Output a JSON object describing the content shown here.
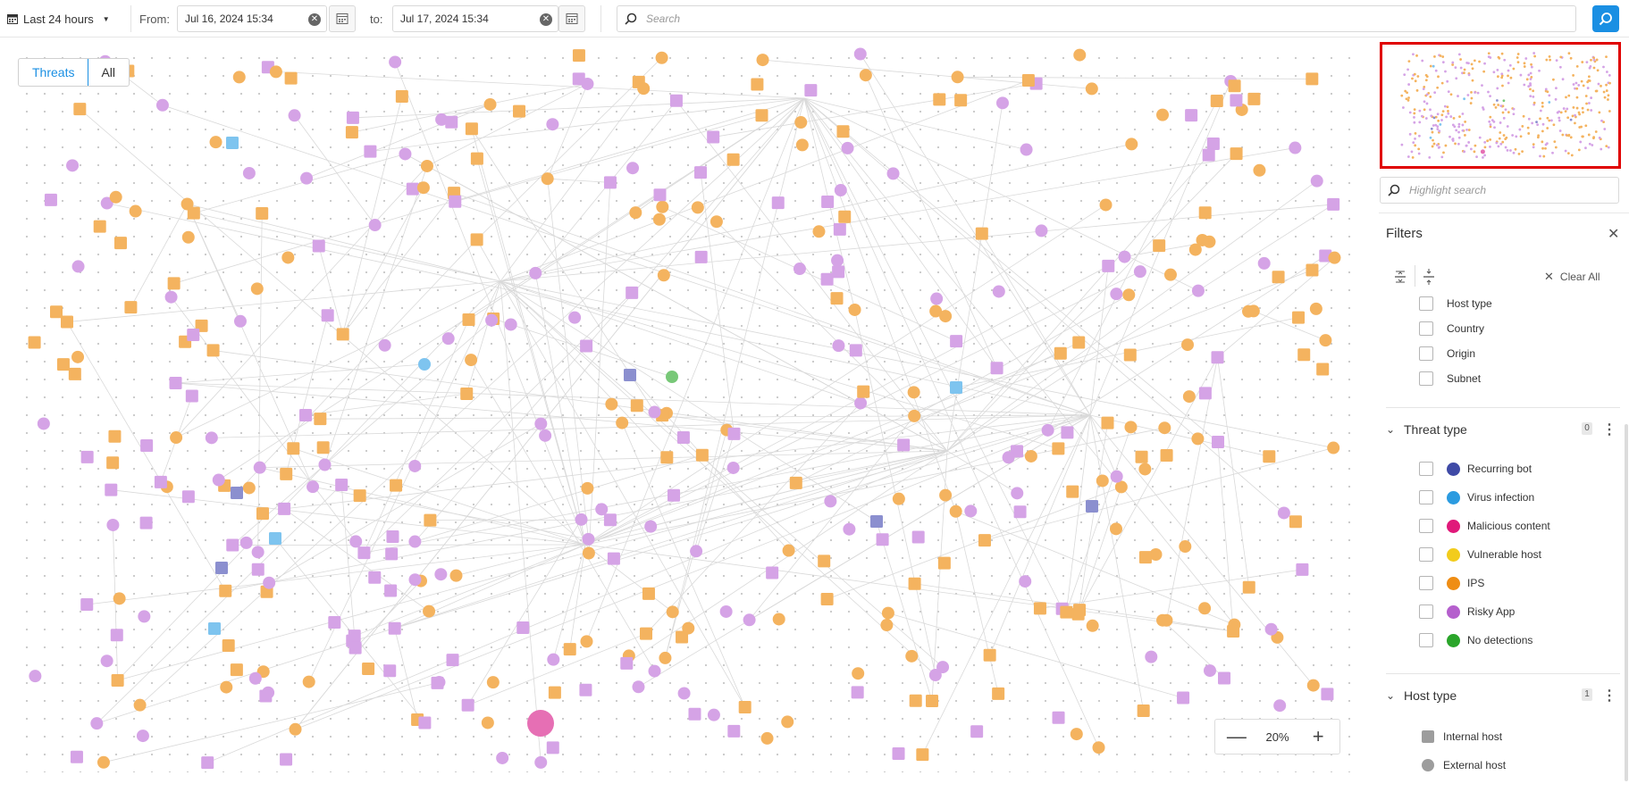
{
  "toolbar": {
    "range_label": "Last 24 hours",
    "from_label": "From:",
    "from_value": "Jul 16, 2024 15:34",
    "to_label": "to:",
    "to_value": "Jul 17, 2024 15:34",
    "search_placeholder": "Search"
  },
  "view_toggle": {
    "threats": "Threats",
    "all": "All",
    "selected": "Threats"
  },
  "zoom": {
    "value": "20%"
  },
  "highlight_search": {
    "placeholder": "Highlight search"
  },
  "filters": {
    "title": "Filters",
    "clear_all": "Clear All",
    "group_options": [
      "Host type",
      "Country",
      "Origin",
      "Subnet"
    ],
    "threat_type": {
      "title": "Threat type",
      "count": "0",
      "items": [
        {
          "label": "Recurring bot",
          "color": "#3f4aa6"
        },
        {
          "label": "Virus infection",
          "color": "#2b9be0"
        },
        {
          "label": "Malicious content",
          "color": "#e0197a"
        },
        {
          "label": "Vulnerable host",
          "color": "#f2cc1c"
        },
        {
          "label": "IPS",
          "color": "#ef8d14"
        },
        {
          "label": "Risky App",
          "color": "#b55fcd"
        },
        {
          "label": "No detections",
          "color": "#2aa52a"
        }
      ]
    },
    "host_type": {
      "title": "Host type",
      "count": "1",
      "items": [
        {
          "label": "Internal host",
          "icon": "square-icon"
        },
        {
          "label": "External host",
          "icon": "circle-icon"
        }
      ]
    }
  },
  "graph_colors": {
    "ips": "#f4b35f",
    "risky_app": "#d5a3e6",
    "bot": "#8b8fcf",
    "virus": "#7ec4ef",
    "no_detection": "#78c878",
    "malicious": "#e66fb4",
    "edge": "#d9d9d9"
  }
}
